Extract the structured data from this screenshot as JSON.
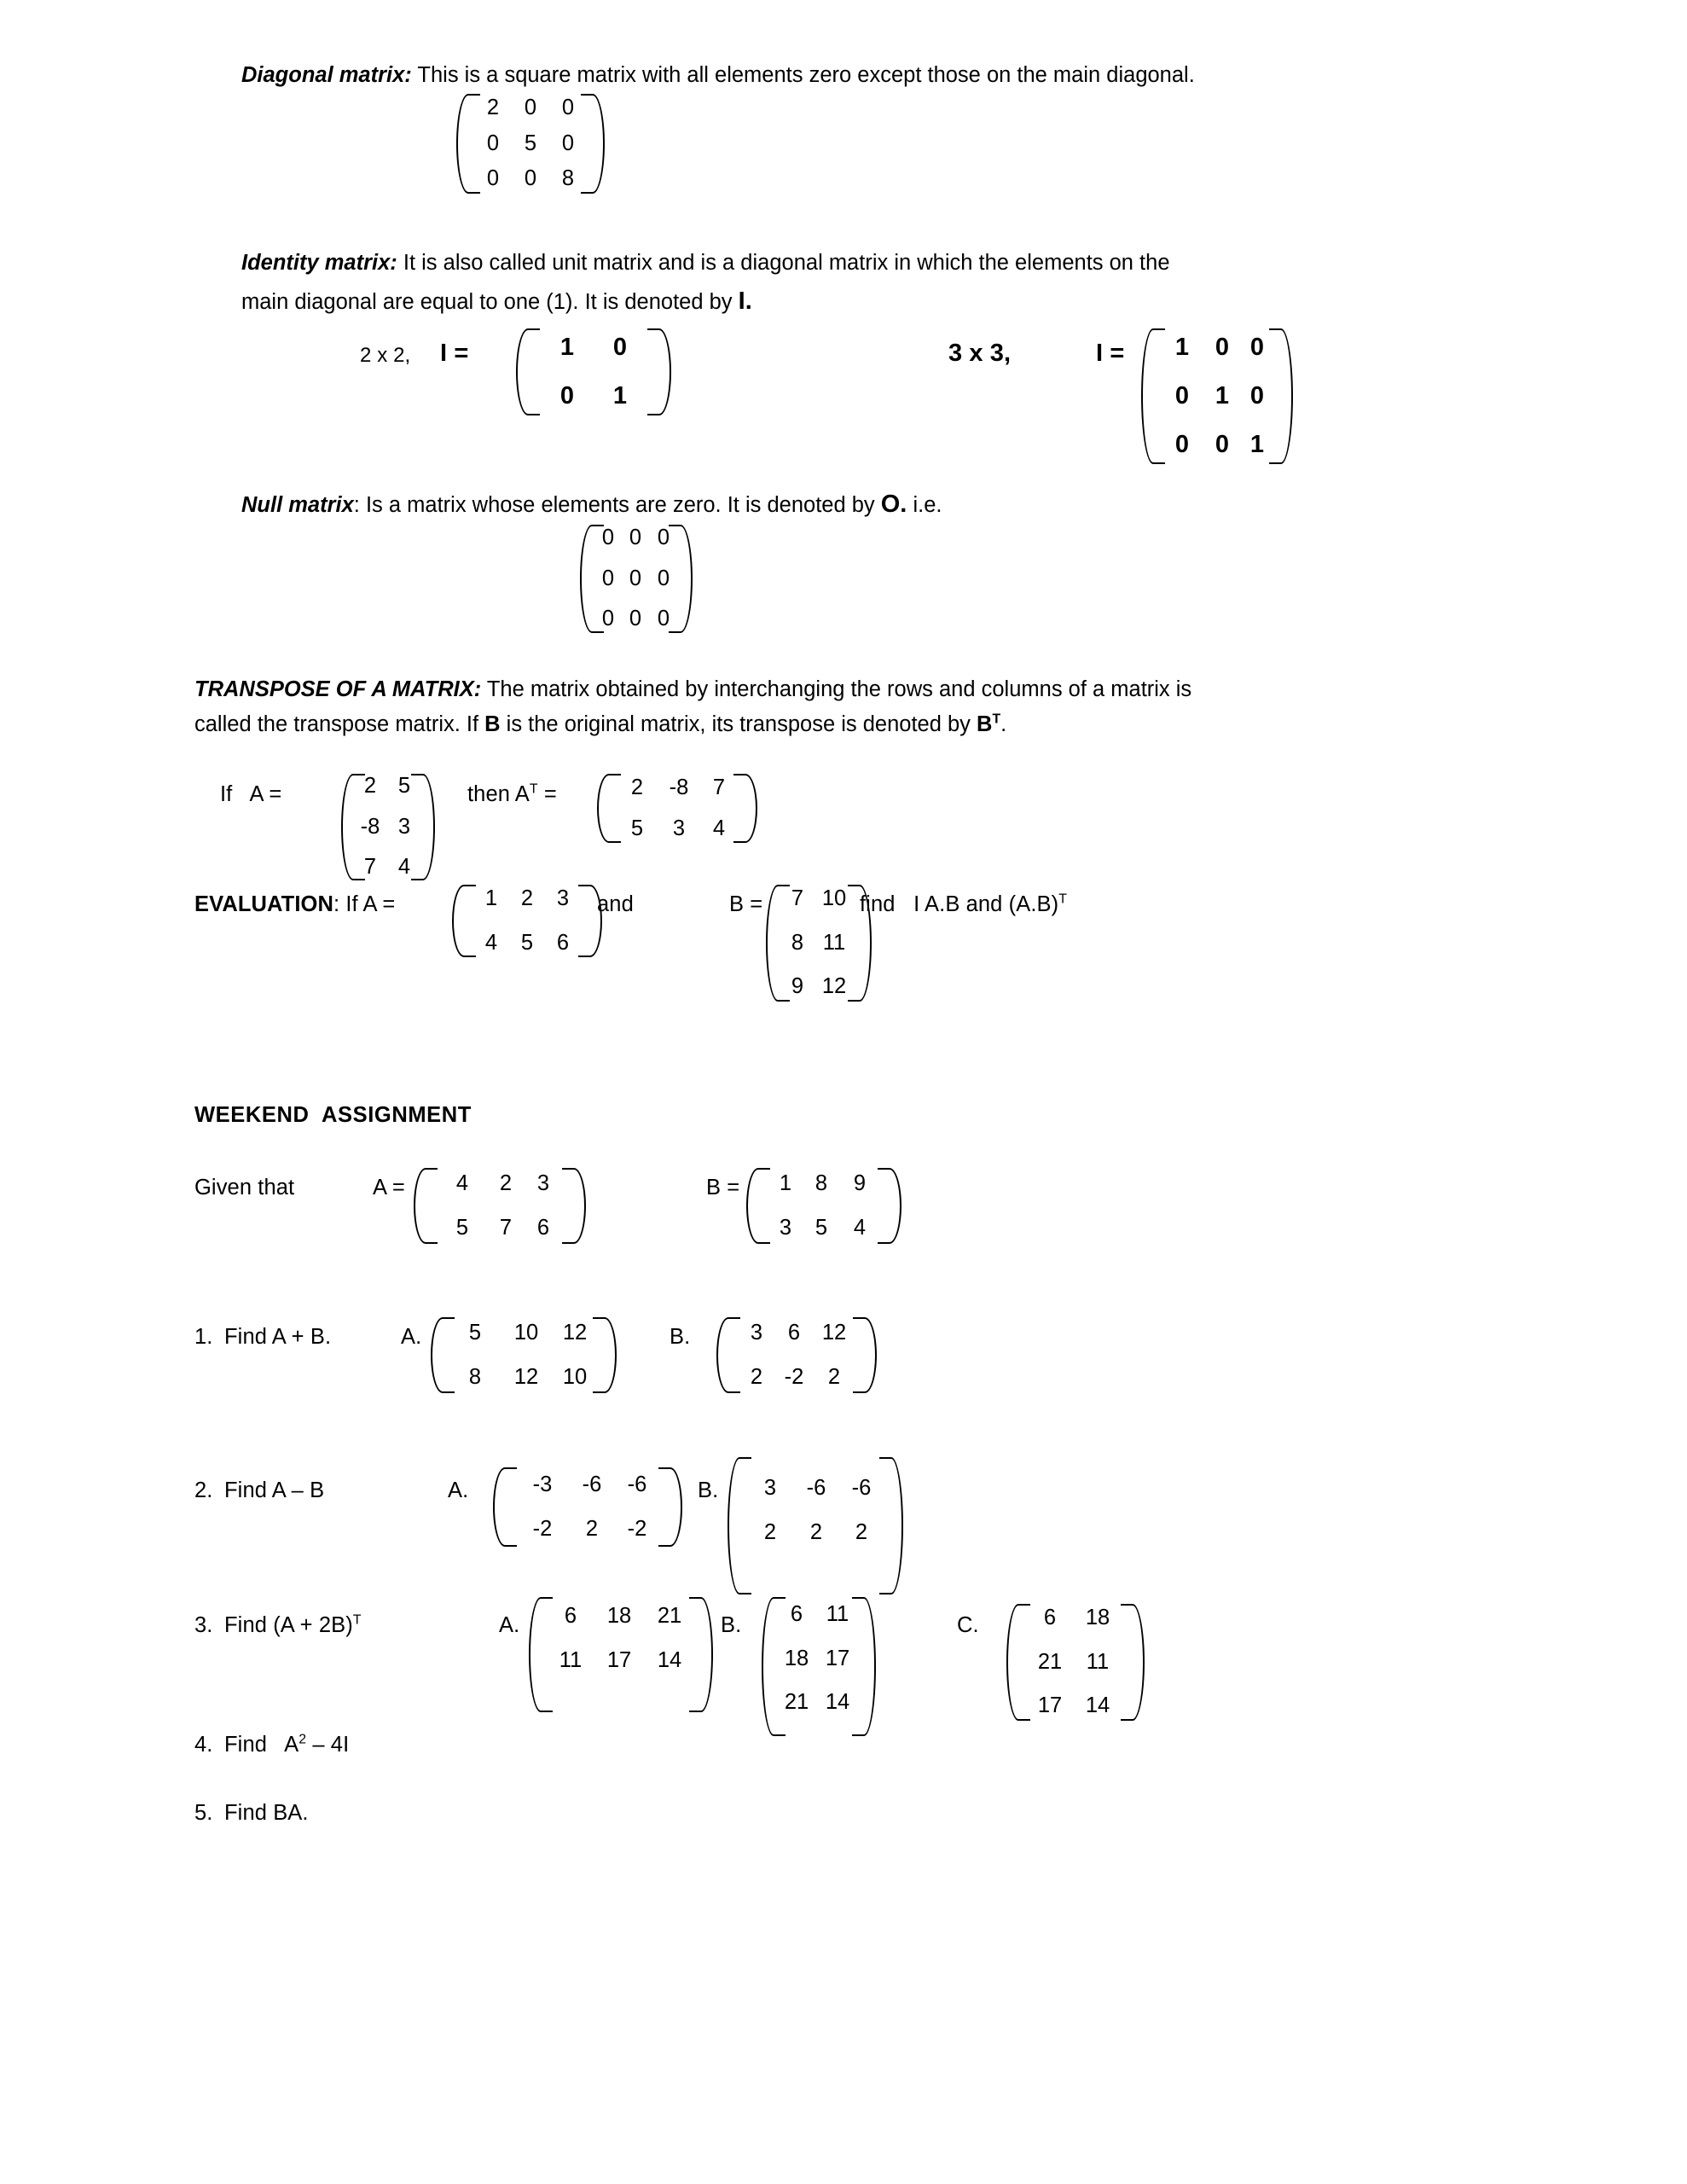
{
  "document": {
    "type": "lesson-notes",
    "topic": "Matrices"
  },
  "sections": {
    "diagonal": {
      "term": "Diagonal matrix:",
      "definition": " This is a square matrix with all elements zero except those on the main diagonal.",
      "matrix": [
        [
          "2",
          "0",
          "0"
        ],
        [
          "0",
          "5",
          "0"
        ],
        [
          "0",
          "0",
          "8"
        ]
      ]
    },
    "identity": {
      "term": "Identity matrix:",
      "definition_line1": " It is also called unit matrix and is a diagonal matrix in which the elements on the",
      "definition_line2": "main diagonal are equal to one (1). It is denoted by ",
      "denoted_symbol": "I.",
      "label_2x2": "2 x 2,",
      "eq_2x2": "I =",
      "matrix_2x2": [
        [
          "1",
          "0"
        ],
        [
          "0",
          "1"
        ]
      ],
      "label_3x3": "3 x 3,",
      "eq_3x3": "I =",
      "matrix_3x3": [
        [
          "1",
          "0",
          "0"
        ],
        [
          "0",
          "1",
          "0"
        ],
        [
          "0",
          "0",
          "1"
        ]
      ]
    },
    "null": {
      "term": "Null matrix",
      "definition": ": Is a matrix whose elements are zero. It is denoted by ",
      "denoted_symbol": "O.",
      "tail": " i.e.",
      "matrix": [
        [
          "0",
          "0",
          "0"
        ],
        [
          "0",
          "0",
          "0"
        ],
        [
          "0",
          "0",
          "0"
        ]
      ]
    },
    "transpose": {
      "heading": "TRANSPOSE OF A MATRIX:",
      "definition_line1": " The matrix obtained by interchanging the rows and columns of a matrix is",
      "definition_line2_a": "called the transpose matrix. If ",
      "definition_line2_b": "B",
      "definition_line2_c": " is the original matrix, its transpose is denoted by ",
      "definition_line2_d": "B",
      "definition_line2_sup": "T",
      "definition_line2_e": ".",
      "if_label": "If   A =",
      "matrix_A": [
        [
          "2",
          "5"
        ],
        [
          "-8",
          "3"
        ],
        [
          "7",
          "4"
        ]
      ],
      "then_label": "then A",
      "then_sup": "T",
      "then_eq": " =",
      "matrix_AT": [
        [
          "2",
          "-8",
          "7"
        ],
        [
          "5",
          "3",
          "4"
        ]
      ]
    },
    "evaluation": {
      "heading": "EVALUATION",
      "intro": ": If A =",
      "matrix_A": [
        [
          "1",
          "2",
          "3"
        ],
        [
          "4",
          "5",
          "6"
        ]
      ],
      "and_label": "and",
      "b_label": "B =",
      "matrix_B": [
        [
          "7",
          "10"
        ],
        [
          "8",
          "11"
        ],
        [
          "9",
          "12"
        ]
      ],
      "find_label": "find   I A.B and (A.B)",
      "find_sup": "T"
    },
    "assignment": {
      "heading": "WEEKEND  ASSIGNMENT",
      "given_label": "Given that",
      "a_label": "A =",
      "matrix_A": [
        [
          "4",
          "2",
          "3"
        ],
        [
          "5",
          "7",
          "6"
        ]
      ],
      "b_label": "B =",
      "matrix_B": [
        [
          "1",
          "8",
          "9"
        ],
        [
          "3",
          "5",
          "4"
        ]
      ],
      "questions": [
        {
          "number": "1.",
          "text": "Find A + B.",
          "options": [
            {
              "letter": "A.",
              "matrix": [
                [
                  "5",
                  "10",
                  "12"
                ],
                [
                  "8",
                  "12",
                  "10"
                ]
              ]
            },
            {
              "letter": "B.",
              "matrix": [
                [
                  "3",
                  "6",
                  "12"
                ],
                [
                  "2",
                  "-2",
                  "2"
                ]
              ]
            }
          ]
        },
        {
          "number": "2.",
          "text": "Find A – B",
          "options": [
            {
              "letter": "A.",
              "matrix": [
                [
                  "-3",
                  "-6",
                  "-6"
                ],
                [
                  "-2",
                  "2",
                  "-2"
                ]
              ]
            },
            {
              "letter": "B.",
              "matrix": [
                [
                  "3",
                  "-6",
                  "-6"
                ],
                [
                  "2",
                  "2",
                  "2"
                ]
              ]
            }
          ]
        },
        {
          "number": "3.",
          "text": "Find (A + 2B)",
          "superscript": "T",
          "options": [
            {
              "letter": "A.",
              "matrix": [
                [
                  "6",
                  "18",
                  "21"
                ],
                [
                  "11",
                  "17",
                  "14"
                ]
              ]
            },
            {
              "letter": "B.",
              "matrix": [
                [
                  "6",
                  "11"
                ],
                [
                  "18",
                  "17"
                ],
                [
                  "21",
                  "14"
                ]
              ]
            },
            {
              "letter": "C.",
              "matrix": [
                [
                  "6",
                  "18"
                ],
                [
                  "21",
                  "11"
                ],
                [
                  "17",
                  "14"
                ]
              ]
            }
          ]
        },
        {
          "number": "4.",
          "text": "Find   A",
          "superscript": "2",
          "text_tail": " – 4I",
          "options": []
        },
        {
          "number": "5.",
          "text": "Find BA.",
          "options": []
        }
      ]
    }
  }
}
